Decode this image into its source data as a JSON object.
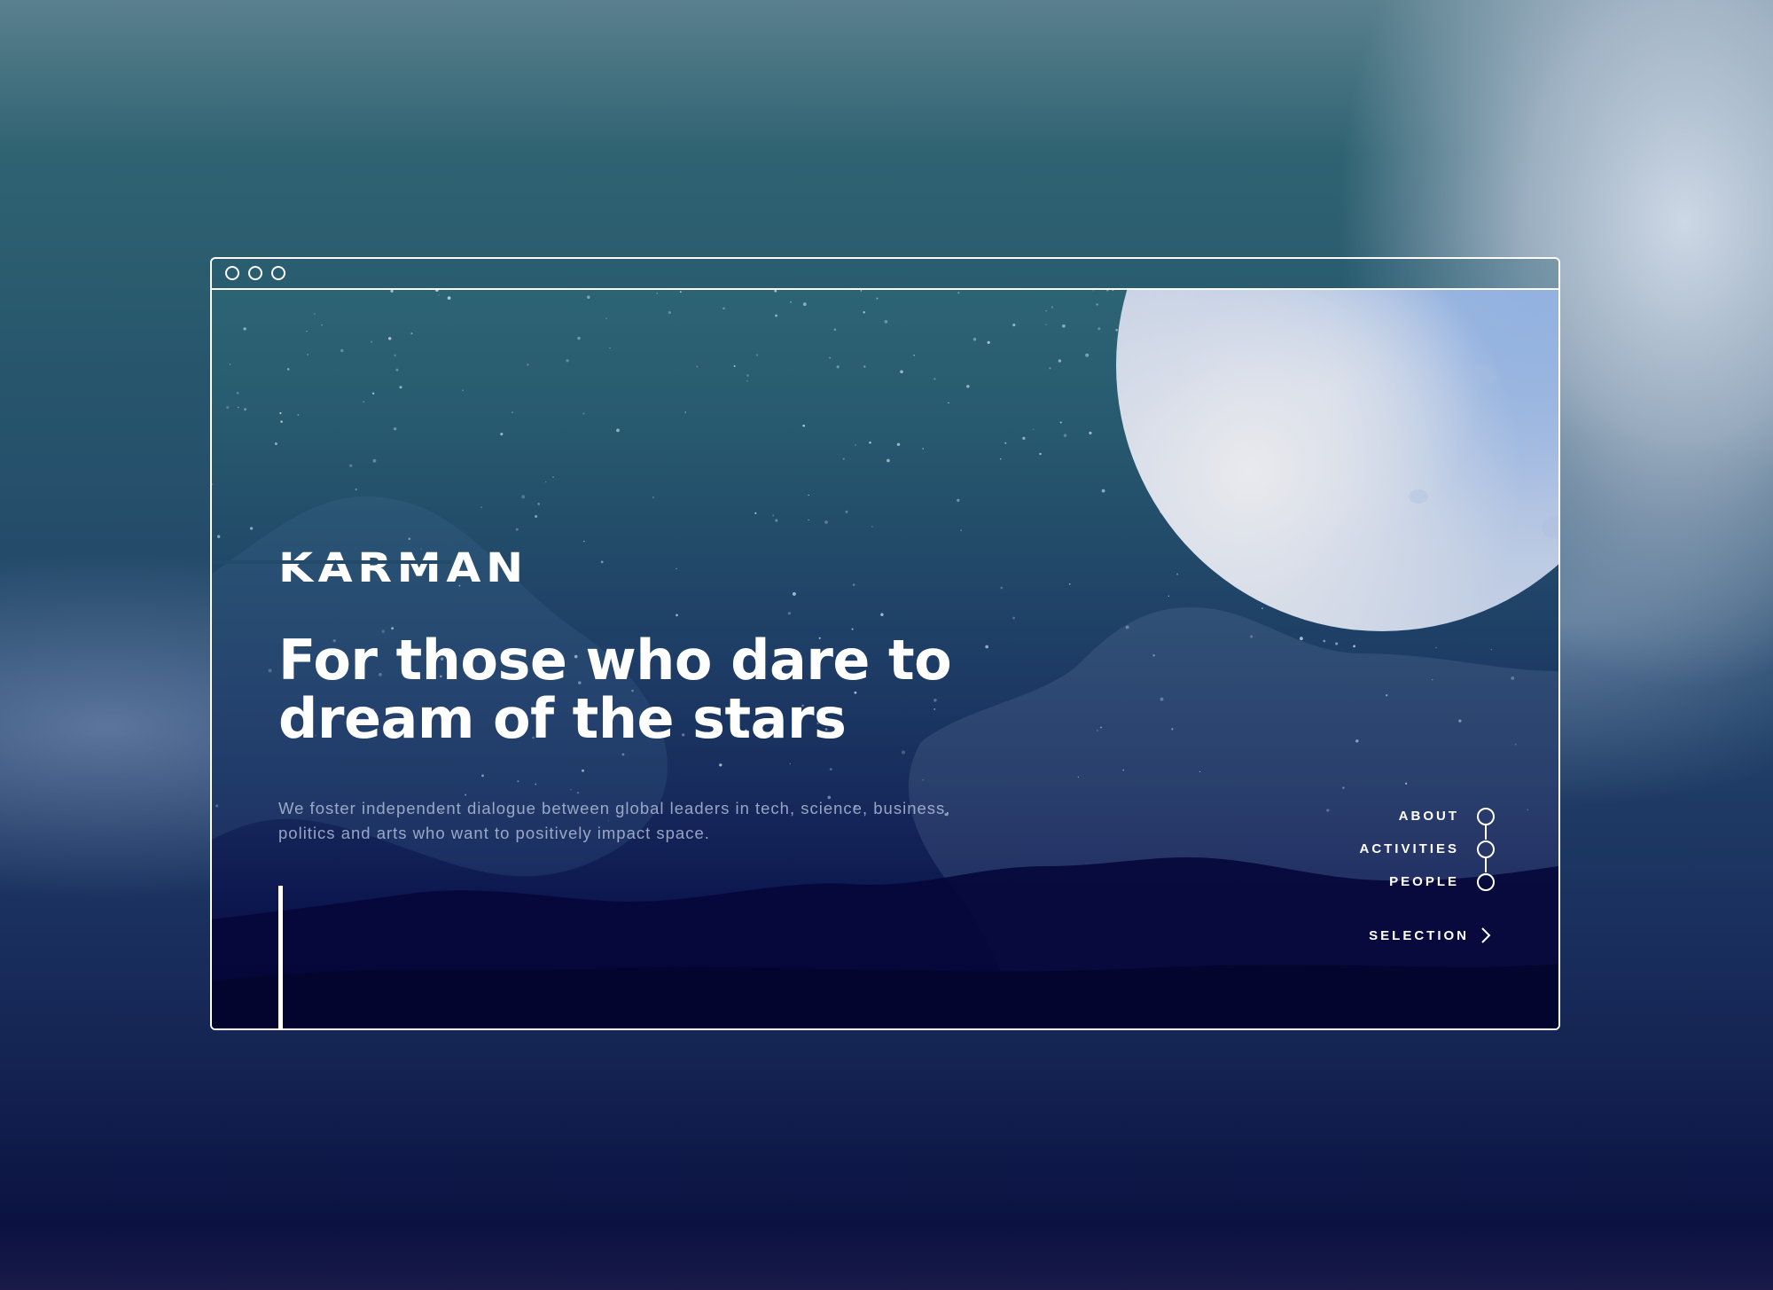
{
  "brand": {
    "logo_text": "KARMAN"
  },
  "hero": {
    "headline": "For those who dare to dream of the stars",
    "subtext": "We foster independent dialogue between global leaders in tech, science, business, politics and arts who want to positively impact space."
  },
  "nav": {
    "items": [
      {
        "label": "ABOUT"
      },
      {
        "label": "ACTIVITIES"
      },
      {
        "label": "PEOPLE"
      }
    ],
    "selection_label": "SELECTION"
  },
  "icons": {
    "window_controls": [
      "window-dot-icon",
      "window-dot-icon",
      "window-dot-icon"
    ],
    "nav_marker": "circle-marker-icon",
    "selection_arrow": "chevron-right-icon"
  },
  "colors": {
    "frame": "#ffffff",
    "sky_top": "#2d6474",
    "sky_bottom": "#060a3a",
    "moon": "#9bb6e0",
    "subtext": "#bec8e1"
  }
}
